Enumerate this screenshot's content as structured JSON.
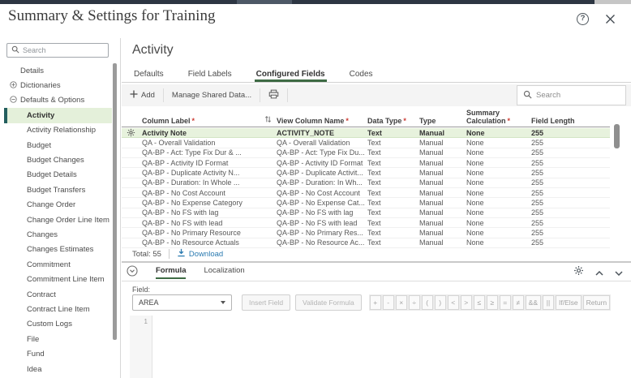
{
  "colors": {
    "accent_green": "#3e6b44",
    "selection_teal": "#235e5e",
    "sidebar_selected_bg": "#e4f0da",
    "row_selected_bg": "#e7f2dd",
    "link_blue": "#2a7ab0"
  },
  "window": {
    "title": "Summary & Settings for Training"
  },
  "icons": {
    "help": "?"
  },
  "sidebar": {
    "search_placeholder": "Search",
    "items": [
      {
        "label": "Details",
        "level": 1,
        "icon": "none"
      },
      {
        "label": "Dictionaries",
        "level": 1,
        "icon": "expand"
      },
      {
        "label": "Defaults & Options",
        "level": 1,
        "icon": "collapse"
      },
      {
        "label": "Activity",
        "level": 2,
        "selected": true
      },
      {
        "label": "Activity Relationship",
        "level": 2
      },
      {
        "label": "Budget",
        "level": 2
      },
      {
        "label": "Budget Changes",
        "level": 2
      },
      {
        "label": "Budget Details",
        "level": 2
      },
      {
        "label": "Budget Transfers",
        "level": 2
      },
      {
        "label": "Change Order",
        "level": 2
      },
      {
        "label": "Change Order Line Item",
        "level": 2
      },
      {
        "label": "Changes",
        "level": 2
      },
      {
        "label": "Changes Estimates",
        "level": 2
      },
      {
        "label": "Commitment",
        "level": 2
      },
      {
        "label": "Commitment Line Item",
        "level": 2
      },
      {
        "label": "Contract",
        "level": 2
      },
      {
        "label": "Contract Line Item",
        "level": 2
      },
      {
        "label": "Custom Logs",
        "level": 2
      },
      {
        "label": "File",
        "level": 2
      },
      {
        "label": "Fund",
        "level": 2
      },
      {
        "label": "Idea",
        "level": 2
      }
    ]
  },
  "main": {
    "title": "Activity",
    "tabs": [
      {
        "label": "Defaults"
      },
      {
        "label": "Field Labels"
      },
      {
        "label": "Configured Fields",
        "active": true
      },
      {
        "label": "Codes"
      }
    ],
    "toolbar": {
      "add_label": "Add",
      "manage_label": "Manage Shared Data...",
      "search_placeholder": "Search"
    }
  },
  "table": {
    "columns": [
      {
        "label": "Column Label",
        "required": true,
        "sort_icon": true
      },
      {
        "label": "View Column Name",
        "required": true
      },
      {
        "label": "Data Type",
        "required": true
      },
      {
        "label": "Type",
        "required": false
      },
      {
        "label": "Summary Calculation",
        "required": true
      },
      {
        "label": "Field Length",
        "required": false
      }
    ],
    "rows": [
      {
        "column_label": "Activity Note",
        "view_column_name": "ACTIVITY_NOTE",
        "data_type": "Text",
        "type": "Manual",
        "summary_calculation": "None",
        "field_length": "255",
        "selected": true
      },
      {
        "column_label": "QA - Overall Validation",
        "view_column_name": "QA - Overall Validation",
        "data_type": "Text",
        "type": "Manual",
        "summary_calculation": "None",
        "field_length": "255"
      },
      {
        "column_label": "QA-BP - Act: Type Fix Dur & ...",
        "view_column_name": "QA-BP - Act: Type Fix Du...",
        "data_type": "Text",
        "type": "Manual",
        "summary_calculation": "None",
        "field_length": "255"
      },
      {
        "column_label": "QA-BP - Activity ID Format",
        "view_column_name": "QA-BP - Activity ID Format",
        "data_type": "Text",
        "type": "Manual",
        "summary_calculation": "None",
        "field_length": "255"
      },
      {
        "column_label": "QA-BP - Duplicate Activity N...",
        "view_column_name": "QA-BP - Duplicate Activit...",
        "data_type": "Text",
        "type": "Manual",
        "summary_calculation": "None",
        "field_length": "255"
      },
      {
        "column_label": "QA-BP - Duration: In Whole ...",
        "view_column_name": "QA-BP - Duration: In Wh...",
        "data_type": "Text",
        "type": "Manual",
        "summary_calculation": "None",
        "field_length": "255"
      },
      {
        "column_label": "QA-BP - No Cost Account",
        "view_column_name": "QA-BP - No Cost Account",
        "data_type": "Text",
        "type": "Manual",
        "summary_calculation": "None",
        "field_length": "255"
      },
      {
        "column_label": "QA-BP - No Expense Category",
        "view_column_name": "QA-BP - No Expense Cat...",
        "data_type": "Text",
        "type": "Manual",
        "summary_calculation": "None",
        "field_length": "255"
      },
      {
        "column_label": "QA-BP - No FS with lag",
        "view_column_name": "QA-BP - No FS with lag",
        "data_type": "Text",
        "type": "Manual",
        "summary_calculation": "None",
        "field_length": "255"
      },
      {
        "column_label": "QA-BP - No FS with lead",
        "view_column_name": "QA-BP - No FS with lead",
        "data_type": "Text",
        "type": "Manual",
        "summary_calculation": "None",
        "field_length": "255"
      },
      {
        "column_label": "QA-BP - No Primary Resource",
        "view_column_name": "QA-BP - No Primary Res...",
        "data_type": "Text",
        "type": "Manual",
        "summary_calculation": "None",
        "field_length": "255"
      },
      {
        "column_label": "QA-BP - No Resource Actuals",
        "view_column_name": "QA-BP - No Resource Ac...",
        "data_type": "Text",
        "type": "Manual",
        "summary_calculation": "None",
        "field_length": "255"
      }
    ],
    "total_label": "Total: 55",
    "download_label": "Download"
  },
  "formula_panel": {
    "tabs": [
      {
        "label": "Formula",
        "active": true
      },
      {
        "label": "Localization"
      }
    ],
    "field_label": "Field:",
    "field_value": "AREA",
    "insert_field_label": "Insert Field",
    "validate_label": "Validate Formula",
    "operators": [
      {
        "label": "+",
        "name": "plus"
      },
      {
        "label": "-",
        "name": "minus"
      },
      {
        "label": "×",
        "name": "multiply"
      },
      {
        "label": "÷",
        "name": "divide"
      },
      {
        "label": "(",
        "name": "paren-open"
      },
      {
        "label": ")",
        "name": "paren-close"
      },
      {
        "label": "<",
        "name": "less-than"
      },
      {
        "label": ">",
        "name": "greater-than"
      },
      {
        "label": "≤",
        "name": "less-equal"
      },
      {
        "label": "≥",
        "name": "greater-equal"
      },
      {
        "label": "=",
        "name": "equals"
      },
      {
        "label": "≠",
        "name": "not-equal"
      },
      {
        "label": "&&",
        "name": "and"
      },
      {
        "label": "||",
        "name": "or"
      },
      {
        "label": "If/Else",
        "name": "if-else"
      },
      {
        "label": "Return",
        "name": "return"
      }
    ],
    "editor": {
      "line_number": "1"
    }
  }
}
